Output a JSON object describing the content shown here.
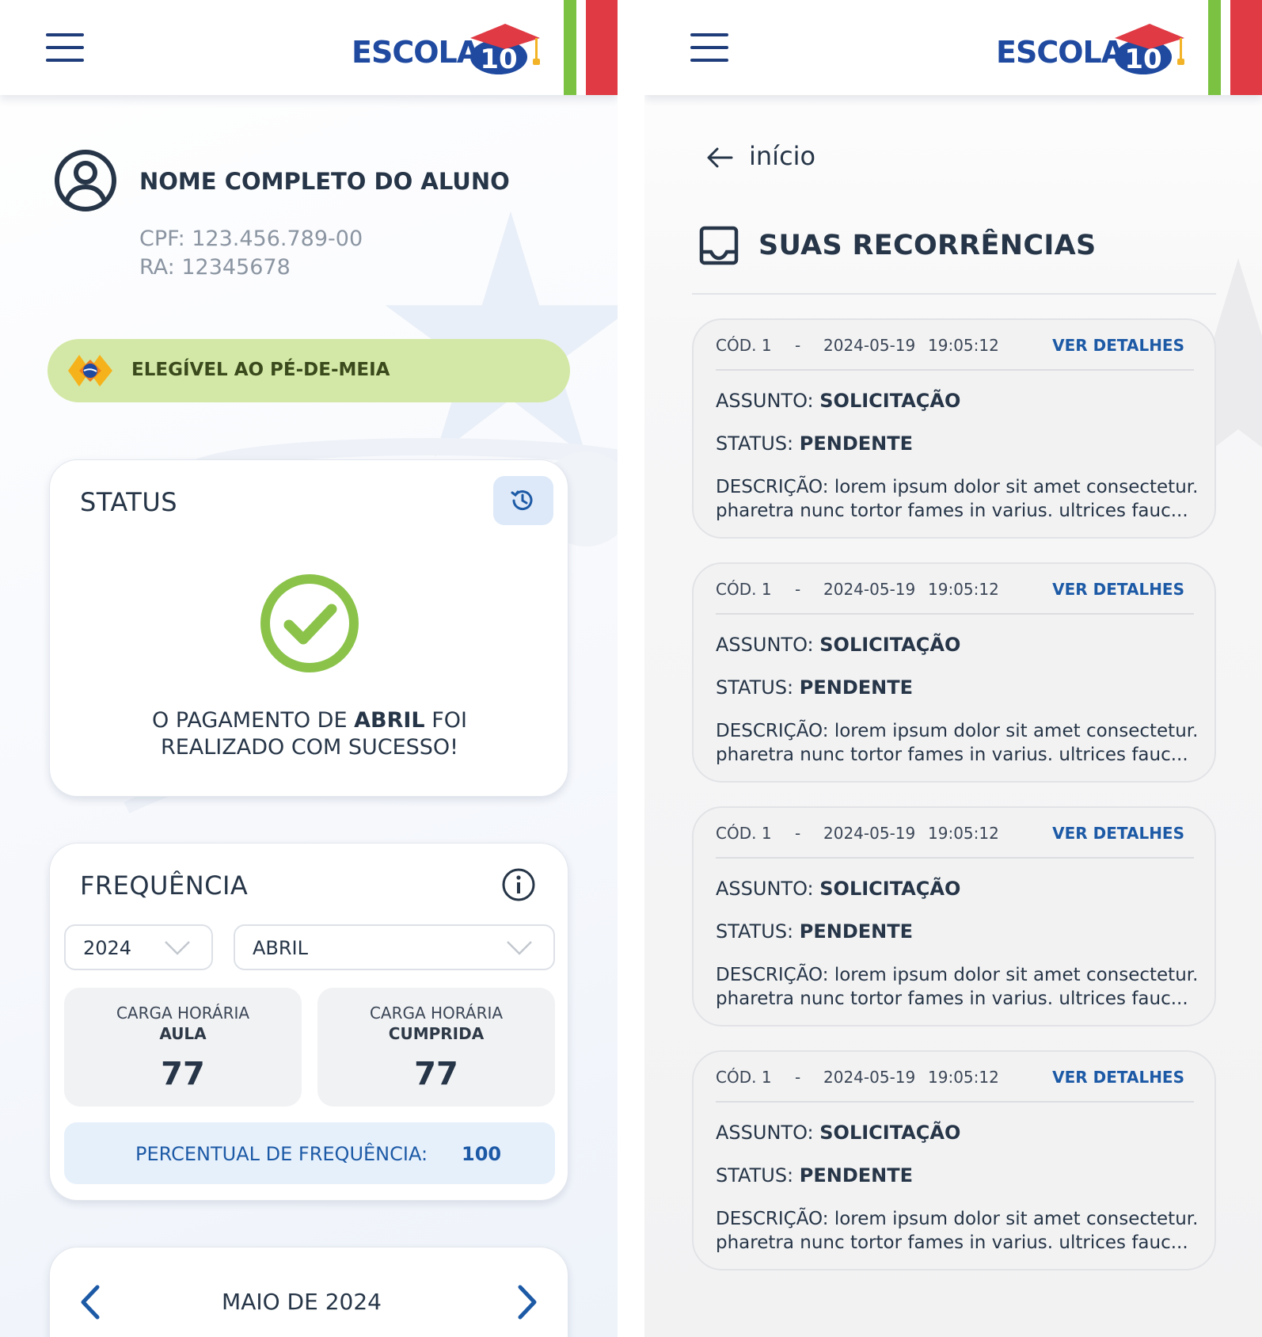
{
  "brand": {
    "logo_text": "ESCOLA",
    "logo_number": "10",
    "colors": {
      "primary": "#1f4aa0",
      "dark_text": "#263547",
      "accent_blue": "#1d5aa6",
      "eligible_bg": "#d3e8a6",
      "success_green": "#8bc34a",
      "flag_green": "#7cc242",
      "flag_red": "#e03a44"
    }
  },
  "left_screen": {
    "header": {
      "menu_icon": "hamburger-menu-icon"
    },
    "student": {
      "name": "NOME COMPLETO DO ALUNO",
      "cpf": "CPF: 123.456.789-00",
      "ra": "RA: 12345678"
    },
    "eligibility": {
      "label": "ELEGÍVEL AO PÉ-DE-MEIA"
    },
    "status_card": {
      "title": "STATUS",
      "message_prefix": "O PAGAMENTO DE ",
      "message_month": "ABRIL",
      "message_suffix": " FOI",
      "message_line2": "REALIZADO COM SUCESSO!"
    },
    "frequency_card": {
      "title": "FREQUÊNCIA",
      "year_select": "2024",
      "month_select": "ABRIL",
      "carga_aula_label_1": "CARGA HORÁRIA",
      "carga_aula_label_2": "AULA",
      "carga_aula_value": "77",
      "carga_cumprida_label_1": "CARGA HORÁRIA",
      "carga_cumprida_label_2": "CUMPRIDA",
      "carga_cumprida_value": "77",
      "percent_label": "PERCENTUAL DE FREQUÊNCIA:",
      "percent_value": "100"
    },
    "calendar": {
      "month_label": "MAIO DE 2024"
    }
  },
  "right_screen": {
    "back_label": "início",
    "page_title": "SUAS RECORRÊNCIAS",
    "recurrences": [
      {
        "code": "CÓD. 1",
        "dash": "-",
        "date": "2024-05-19",
        "time": "19:05:12",
        "details_label": "VER DETALHES",
        "subject_label": "ASSUNTO: ",
        "subject_value": "SOLICITAÇÃO",
        "status_label": "STATUS: ",
        "status_value": "PENDENTE",
        "description": "DESCRIÇÃO: lorem ipsum dolor sit amet consectetur. pharetra nunc tortor fames in varius. ultrices fauc..."
      },
      {
        "code": "CÓD. 1",
        "dash": "-",
        "date": "2024-05-19",
        "time": "19:05:12",
        "details_label": "VER DETALHES",
        "subject_label": "ASSUNTO: ",
        "subject_value": "SOLICITAÇÃO",
        "status_label": "STATUS: ",
        "status_value": "PENDENTE",
        "description": "DESCRIÇÃO: lorem ipsum dolor sit amet consectetur. pharetra nunc tortor fames in varius. ultrices fauc..."
      },
      {
        "code": "CÓD. 1",
        "dash": "-",
        "date": "2024-05-19",
        "time": "19:05:12",
        "details_label": "VER DETALHES",
        "subject_label": "ASSUNTO: ",
        "subject_value": "SOLICITAÇÃO",
        "status_label": "STATUS: ",
        "status_value": "PENDENTE",
        "description": "DESCRIÇÃO: lorem ipsum dolor sit amet consectetur. pharetra nunc tortor fames in varius. ultrices fauc..."
      },
      {
        "code": "CÓD. 1",
        "dash": "-",
        "date": "2024-05-19",
        "time": "19:05:12",
        "details_label": "VER DETALHES",
        "subject_label": "ASSUNTO: ",
        "subject_value": "SOLICITAÇÃO",
        "status_label": "STATUS: ",
        "status_value": "PENDENTE",
        "description": "DESCRIÇÃO: lorem ipsum dolor sit amet consectetur. pharetra nunc tortor fames in varius. ultrices fauc..."
      }
    ]
  }
}
